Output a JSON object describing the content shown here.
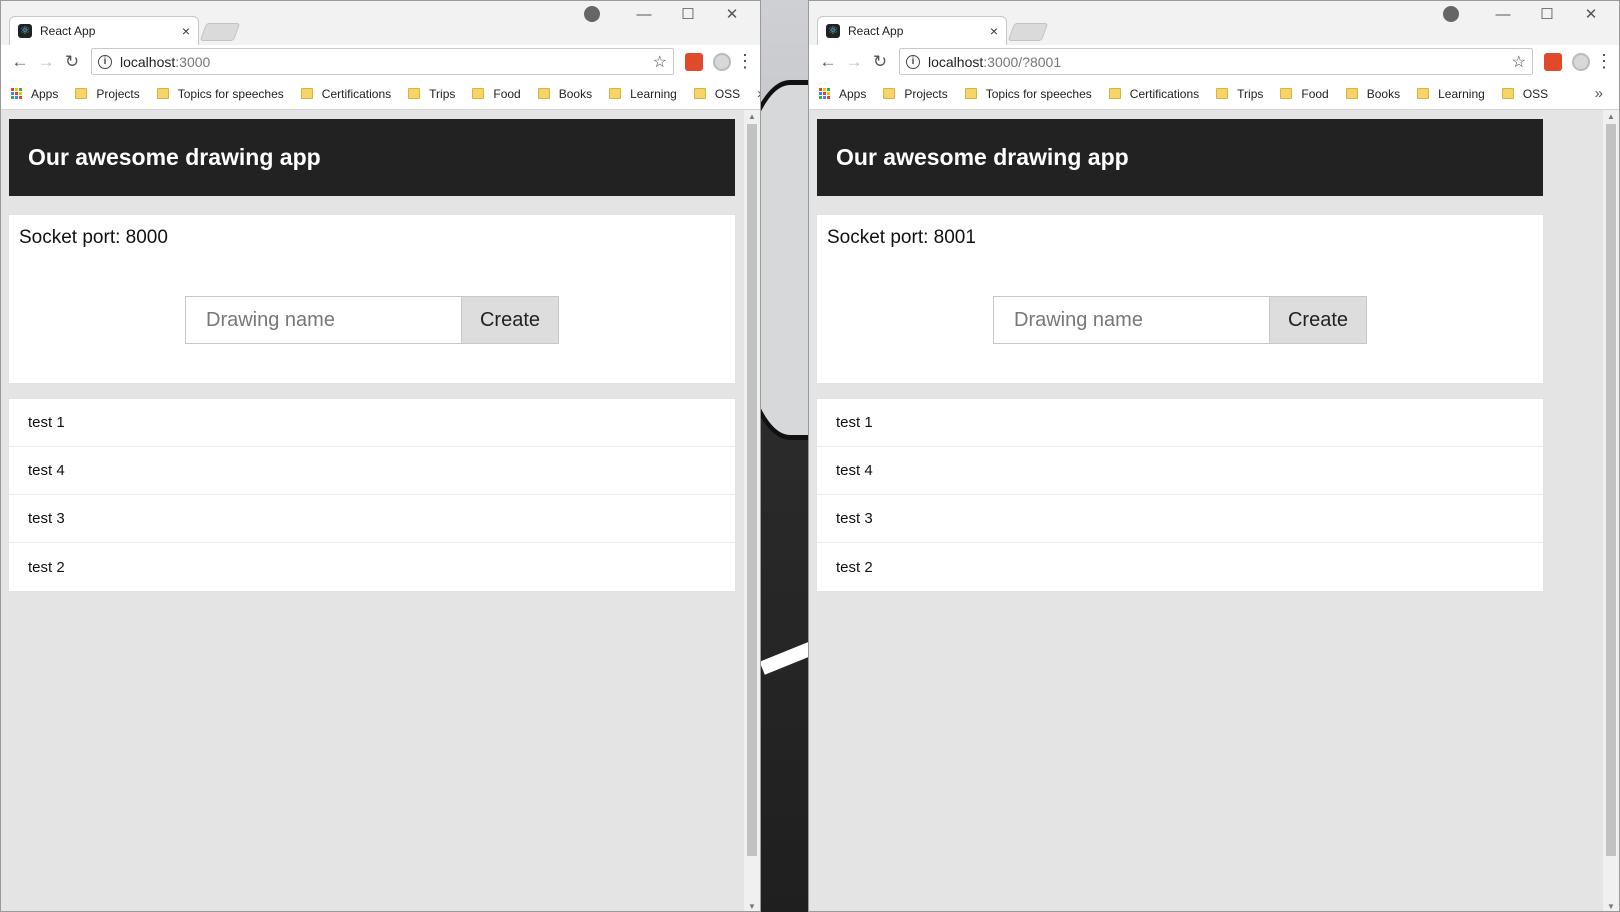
{
  "windows": [
    {
      "tab_title": "React App",
      "url_host": "localhost",
      "url_rest": ":3000",
      "header_title": "Our awesome drawing app",
      "socket_text": "Socket port: 8000",
      "input_placeholder": "Drawing name",
      "create_label": "Create",
      "drawings": [
        "test 1",
        "test 4",
        "test 3",
        "test 2"
      ]
    },
    {
      "tab_title": "React App",
      "url_host": "localhost",
      "url_rest": ":3000/?8001",
      "header_title": "Our awesome drawing app",
      "socket_text": "Socket port: 8001",
      "input_placeholder": "Drawing name",
      "create_label": "Create",
      "drawings": [
        "test 1",
        "test 4",
        "test 3",
        "test 2"
      ]
    }
  ],
  "bookmarks": {
    "apps": "Apps",
    "folders": [
      "Projects",
      "Topics for speeches",
      "Certifications",
      "Trips",
      "Food",
      "Books",
      "Learning",
      "OSS"
    ],
    "more": "»"
  },
  "icons": {
    "tab_close": "×",
    "back": "←",
    "forward": "→",
    "reload": "↻",
    "star": "☆",
    "menu": "⋮",
    "minimize": "—",
    "maximize": "☐",
    "close": "✕",
    "favicon": "⚛",
    "info": "i"
  }
}
